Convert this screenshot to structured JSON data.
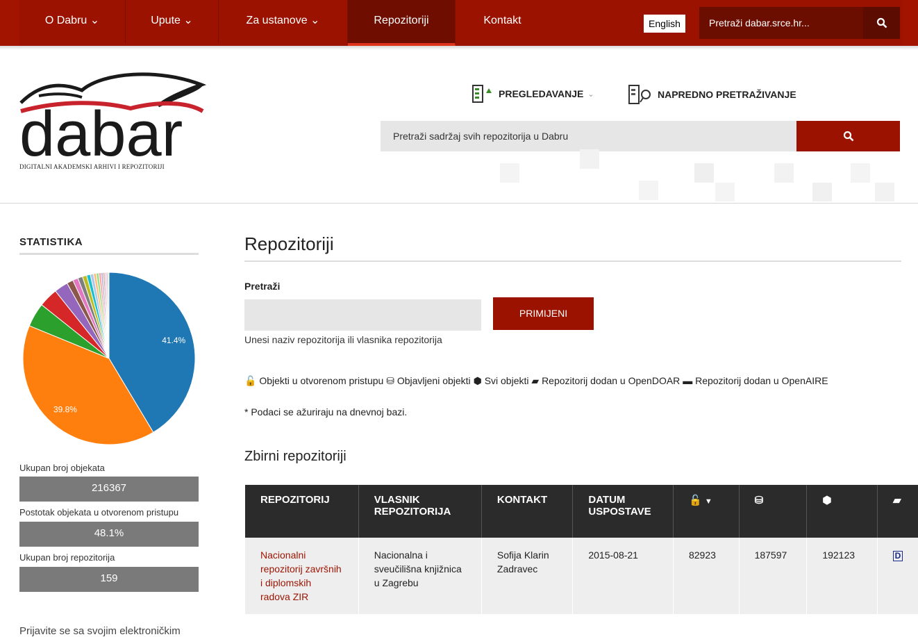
{
  "topnav": {
    "items": [
      {
        "label": "O Dabru ⌄"
      },
      {
        "label": "Upute ⌄"
      },
      {
        "label": "Za ustanove ⌄"
      },
      {
        "label": "Repozitoriji"
      },
      {
        "label": "Kontakt"
      }
    ],
    "language_button": "English",
    "search_placeholder": "Pretraži dabar.srce.hr...",
    "search_icon": "search-icon"
  },
  "logo": {
    "text": "dabar",
    "tagline": "DIGITALNI AKADEMSKI ARHIVI I REPOZITORIJI"
  },
  "header": {
    "browse_label": "PREGLEDAVANJE",
    "advanced_label": "NAPREDNO PRETRAŽIVANJE",
    "search_placeholder": "Pretraži sadržaj svih repozitorija u Dabru"
  },
  "sidebar": {
    "title": "STATISTIKA",
    "stats": [
      {
        "label": "Ukupan broj objekata",
        "value": "216367"
      },
      {
        "label": "Postotak objekata u otvorenom pristupu",
        "value": "48.1%"
      },
      {
        "label": "Ukupan broj repozitorija",
        "value": "159"
      }
    ],
    "login_text": "Prijavite se sa svojim elektroničkim"
  },
  "chart_data": {
    "type": "pie",
    "slices": [
      {
        "value": 41.4,
        "label": "41.4%",
        "color": "#1f77b4"
      },
      {
        "value": 39.8,
        "label": "39.8%",
        "color": "#ff7f0e"
      },
      {
        "value": 4.5,
        "label": "",
        "color": "#2ca02c"
      },
      {
        "value": 3.6,
        "label": "",
        "color": "#d62728"
      },
      {
        "value": 2.6,
        "label": "",
        "color": "#9467bd"
      },
      {
        "value": 1.2,
        "label": "",
        "color": "#8c564b"
      },
      {
        "value": 1.0,
        "label": "",
        "color": "#e377c2"
      },
      {
        "value": 0.9,
        "label": "",
        "color": "#7f7f7f"
      },
      {
        "value": 0.8,
        "label": "",
        "color": "#bcbd22"
      },
      {
        "value": 0.7,
        "label": "",
        "color": "#17becf"
      },
      {
        "value": 0.6,
        "label": "",
        "color": "#aec7e8"
      },
      {
        "value": 0.5,
        "label": "",
        "color": "#ffbb78"
      },
      {
        "value": 0.5,
        "label": "",
        "color": "#98df8a"
      },
      {
        "value": 0.4,
        "label": "",
        "color": "#ff9896"
      },
      {
        "value": 0.4,
        "label": "",
        "color": "#c5b0d5"
      },
      {
        "value": 0.3,
        "label": "",
        "color": "#c49c94"
      },
      {
        "value": 0.3,
        "label": "",
        "color": "#f7b6d2"
      },
      {
        "value": 0.3,
        "label": "",
        "color": "#c7c7c7"
      },
      {
        "value": 0.2,
        "label": "",
        "color": "#dbdb8d"
      }
    ]
  },
  "main": {
    "title": "Repozitoriji",
    "search_label": "Pretraži",
    "apply_button": "PRIMIJENI",
    "search_help": "Unesi naziv repozitorija ili vlasnika repozitorija",
    "legend_text": "Objekti u otvorenom pristupu 🙵 Objavljeni objekti Svi objekti Repozitorij dodan u OpenDOAR Repozitorij dodan u OpenAIRE",
    "legend_parts": [
      {
        "icon": "unlock-icon",
        "glyph": "🔓",
        "label": "Objekti u otvorenom pristupu"
      },
      {
        "icon": "cubes-icon",
        "glyph": "⛁",
        "label": "Objavljeni objekti"
      },
      {
        "icon": "cube-icon",
        "glyph": "⬢",
        "label": "Svi objekti"
      },
      {
        "icon": "book-icon",
        "glyph": "▰",
        "label": "Repozitorij dodan u OpenDOAR"
      },
      {
        "icon": "archive-icon",
        "glyph": "▬",
        "label": "Repozitorij dodan u OpenAIRE"
      }
    ],
    "note": "* Podaci se ažuriraju na dnevnoj bazi.",
    "section_title": "Zbirni repozitoriji",
    "table": {
      "headers": [
        "REPOZITORIJ",
        "VLASNIK REPOZITORIJA",
        "KONTAKT",
        "DATUM USPOSTAVE"
      ],
      "rows": [
        {
          "repo": "Nacionalni repozitorij završnih i diplomskih radova ZIR",
          "owner": "Nacionalna i sveučilišna knjižnica u Zagrebu",
          "contact": "Sofija Klarin Zadravec",
          "date": "2015-08-21",
          "open": "82923",
          "published": "187597",
          "all": "192123",
          "doar": "D"
        }
      ]
    }
  }
}
